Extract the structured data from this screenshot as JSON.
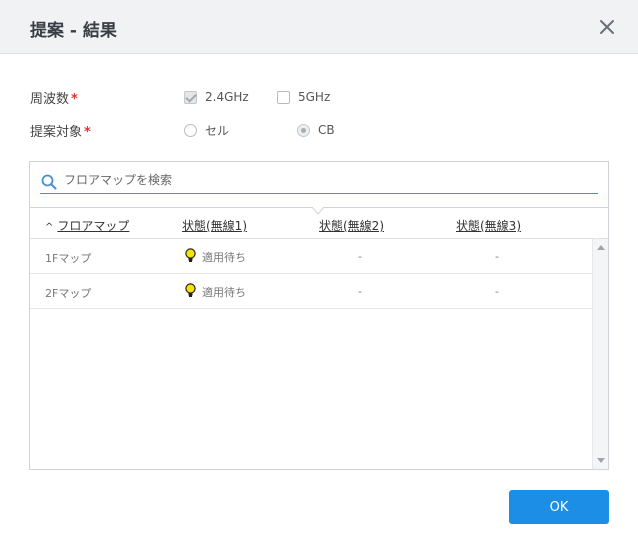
{
  "dialog": {
    "title": "提案 - 結果",
    "close_icon": "close-icon"
  },
  "form": {
    "frequency": {
      "label": "周波数",
      "required_mark": "*",
      "options": [
        {
          "label": "2.4GHz",
          "checked": true,
          "disabled": true
        },
        {
          "label": "5GHz",
          "checked": false,
          "disabled": true
        }
      ]
    },
    "target": {
      "label": "提案対象",
      "required_mark": "*",
      "options": [
        {
          "label": "セル",
          "checked": false,
          "disabled": true
        },
        {
          "label": "CB",
          "checked": true,
          "disabled": true
        }
      ]
    }
  },
  "search": {
    "placeholder": "フロアマップを検索",
    "value": "",
    "icon": "search-icon",
    "accent": "#4a8fd0"
  },
  "table": {
    "sort_indicator": "^",
    "columns": [
      "フロアマップ",
      "状態(無線1)",
      "状態(無線2)",
      "状態(無線3)"
    ],
    "rows": [
      {
        "map": "1Fマップ",
        "status1": "適用待ち",
        "status1_icon": "lightbulb-icon",
        "status2": "-",
        "status3": "-"
      },
      {
        "map": "2Fマップ",
        "status1": "適用待ち",
        "status1_icon": "lightbulb-icon",
        "status2": "-",
        "status3": "-"
      }
    ]
  },
  "footer": {
    "ok_label": "OK",
    "ok_color": "#1c8ee6"
  }
}
